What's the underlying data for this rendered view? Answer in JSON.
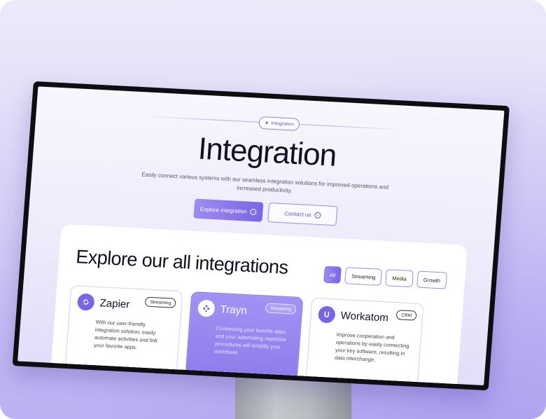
{
  "hero": {
    "badge": "Integration",
    "title": "Integration",
    "subtitle": "Easily connect various systems with our seamless integration solutions for improved operations and increased productivity.",
    "primary_button": "Explore integration",
    "secondary_button": "Contact us"
  },
  "section": {
    "title": "Explore our all integrations",
    "filters": [
      {
        "label": "All",
        "active": true
      },
      {
        "label": "Streaming",
        "active": false
      },
      {
        "label": "Media",
        "active": false
      },
      {
        "label": "Growth",
        "active": false
      }
    ]
  },
  "cards": [
    {
      "name": "Zapier",
      "tag": "Streaming",
      "icon": "zapier-icon",
      "description": "With our user-friendly integration solution, easily automate activities and link your favorite apps.",
      "highlighted": false
    },
    {
      "name": "Trayn",
      "tag": "Streaming",
      "icon": "trayn-icon",
      "description": "Connecting your favorite apps and your automating repetitive procedures will simplify your workflows.",
      "highlighted": true
    },
    {
      "name": "Workatom",
      "tag": "CRM",
      "icon": "workatom-icon",
      "description": "Improve cooperation and operations by easily connecting your key software, resulting in data interchange.",
      "highlighted": false
    }
  ],
  "colors": {
    "accent": "#7b65e6",
    "accent_light": "#9e8bf2",
    "text_dark": "#111126"
  }
}
